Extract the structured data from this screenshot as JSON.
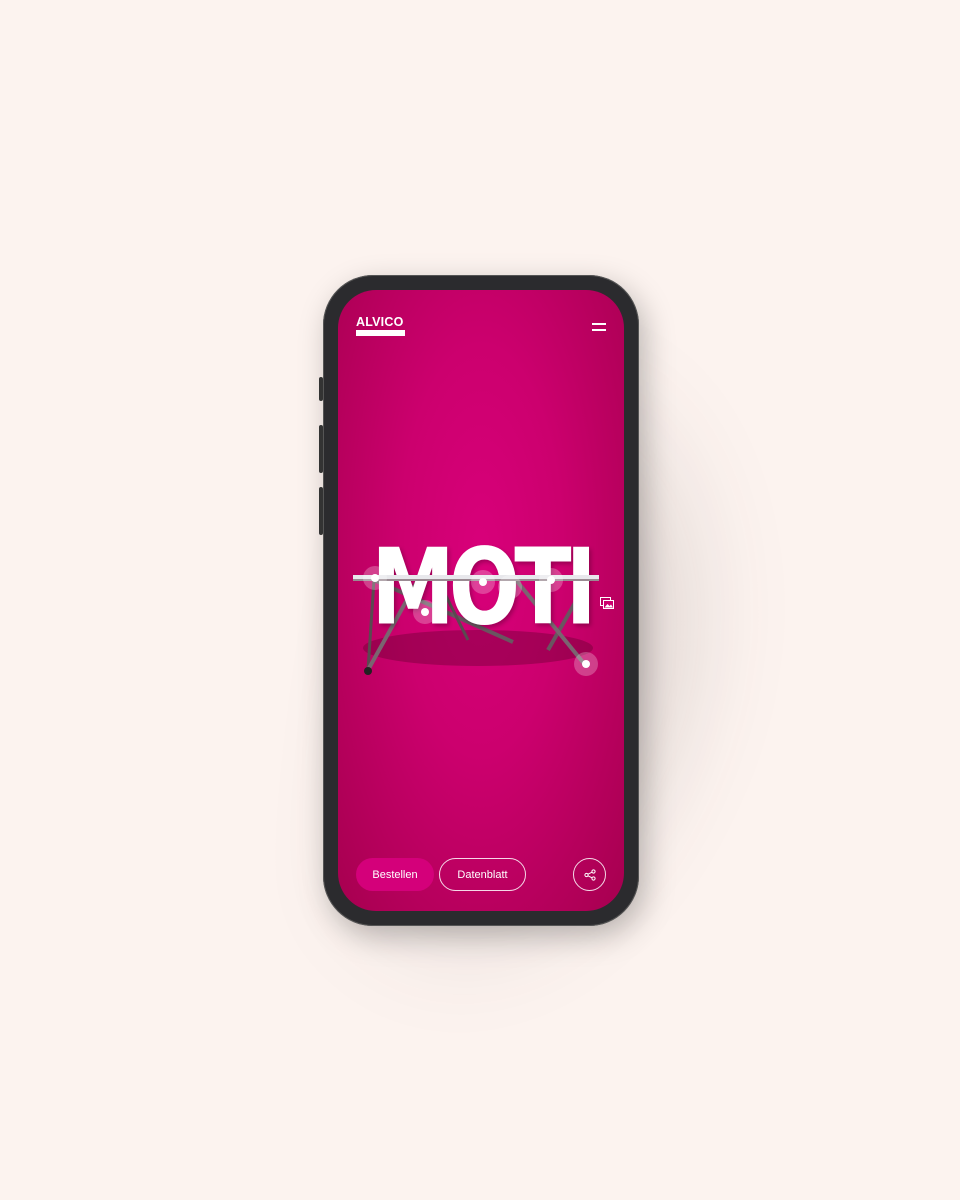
{
  "header": {
    "logo_text": "ALVICO"
  },
  "hero": {
    "title": "MOTI"
  },
  "actions": {
    "order_label": "Bestellen",
    "datasheet_label": "Datenblatt"
  },
  "icons": {
    "menu": "hamburger-menu-icon",
    "image": "image-icon",
    "share": "share-icon"
  },
  "colors": {
    "background": "#fcf3ef",
    "screen": "#cc006e",
    "button_primary": "#d4007a"
  }
}
